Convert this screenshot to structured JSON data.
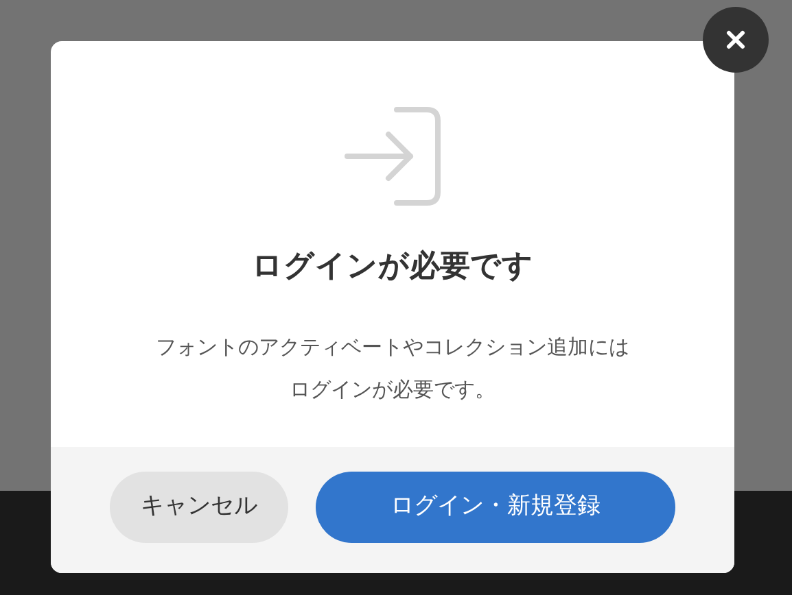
{
  "dialog": {
    "title": "ログインが必要です",
    "message_lines": [
      "フォントのアクティベートやコレクション追加には",
      "ログインが必要です。"
    ],
    "buttons": [
      {
        "label": "キャンセル",
        "kind": "secondary"
      },
      {
        "label": "ログイン・新規登録",
        "kind": "primary"
      }
    ]
  }
}
